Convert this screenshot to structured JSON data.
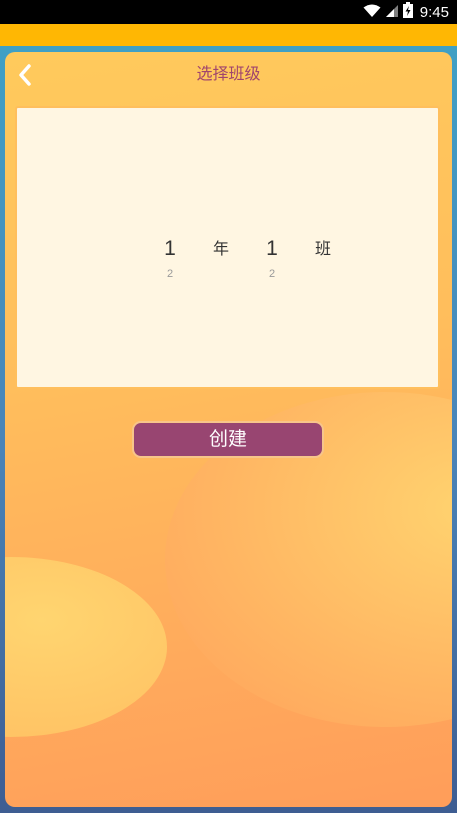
{
  "status_bar": {
    "time": "9:45",
    "icons": [
      "wifi-icon",
      "signal-icon",
      "battery-charging-icon"
    ]
  },
  "header": {
    "title": "选择班级",
    "back_icon": "chevron-left-icon"
  },
  "picker": {
    "grade": {
      "selected": "1",
      "next": "2",
      "unit": "年"
    },
    "class": {
      "selected": "1",
      "next": "2",
      "unit": "班"
    }
  },
  "actions": {
    "create_label": "创建"
  },
  "colors": {
    "status_bar": "#000000",
    "top_strip": "#ffb703",
    "card_start": "#ffca5c",
    "card_end": "#ff9d5a",
    "title": "#a0456d",
    "picker_bg": "#fff6e2",
    "picker_border": "#ffbf5d",
    "button_bg": "#984571",
    "button_border": "#f7c58a"
  }
}
